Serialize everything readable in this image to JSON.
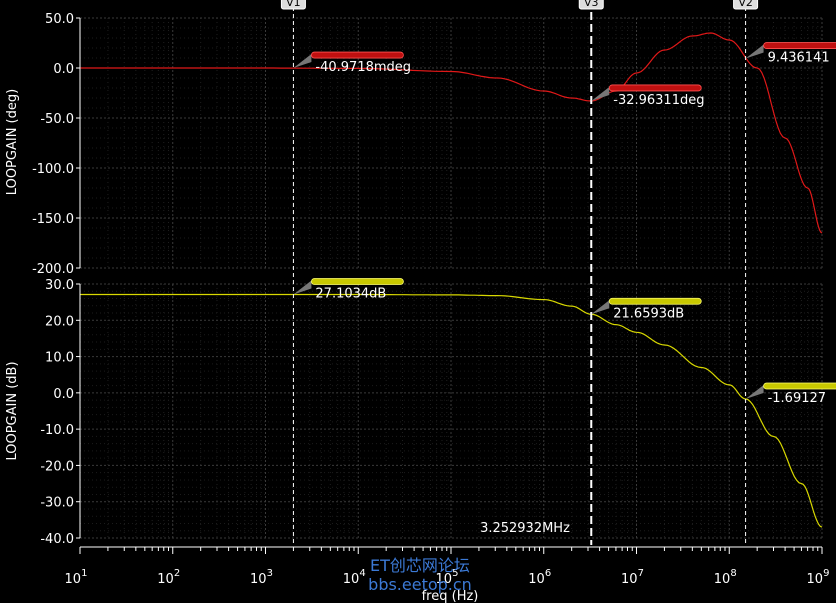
{
  "chart_data": [
    {
      "type": "line",
      "ylabel": "LOOPGAIN (deg)",
      "xlabel": "freq (Hz)",
      "xscale": "log",
      "xlim": [
        10,
        1000000000
      ],
      "ylim": [
        -200,
        50
      ],
      "yticks": [
        "50.0",
        "0.0",
        "-50.0",
        "-100.0",
        "-150.0",
        "-200.0"
      ],
      "grid": true,
      "series": [
        {
          "color": "#e01818",
          "x": [
            10,
            100,
            1000,
            10000,
            100000,
            316228,
            1000000,
            2000000,
            3252932,
            6000000,
            10000000,
            20000000,
            40000000,
            63000000,
            100000000,
            200000000,
            400000000,
            700000000,
            1000000000
          ],
          "y": [
            0,
            0,
            -0.04,
            -0.4,
            -3.5,
            -10,
            -23,
            -30,
            -33,
            -23,
            -5,
            18,
            32,
            35,
            28,
            0,
            -70,
            -120,
            -165
          ]
        }
      ],
      "markers": [
        {
          "label": "-40.9718mdeg",
          "x": 2000,
          "y": -0.04
        },
        {
          "label": "-32.96311deg",
          "x": 3252932,
          "y": -32.96
        },
        {
          "label": "9.436141",
          "x": 150000000,
          "y": 9.44
        }
      ]
    },
    {
      "type": "line",
      "ylabel": "LOOPGAIN (dB)",
      "xlabel": "freq (Hz)",
      "xscale": "log",
      "xlim": [
        10,
        1000000000
      ],
      "ylim": [
        -40,
        30
      ],
      "yticks": [
        "30.0",
        "20.0",
        "10.0",
        "0.0",
        "-10.0",
        "-20.0",
        "-30.0",
        "-40.0"
      ],
      "grid": true,
      "series": [
        {
          "color": "#d8d800",
          "x": [
            10,
            100,
            1000,
            10000,
            100000,
            316228,
            1000000,
            2000000,
            3252932,
            6000000,
            10000000,
            20000000,
            50000000,
            100000000,
            150000000,
            300000000,
            600000000,
            1000000000
          ],
          "y": [
            27.1,
            27.1,
            27.1,
            27.1,
            27.0,
            26.8,
            25.7,
            23.9,
            21.66,
            18.8,
            16.7,
            13.2,
            7.0,
            2.2,
            -1.69,
            -12,
            -25,
            -37
          ]
        }
      ],
      "markers": [
        {
          "label": "27.1034dB",
          "x": 2000,
          "y": 27.1
        },
        {
          "label": "21.6593dB",
          "x": 3252932,
          "y": 21.66
        },
        {
          "label": "-1.69127",
          "x": 150000000,
          "y": -1.69
        }
      ]
    }
  ],
  "x_ticks": [
    {
      "base": "10",
      "exp": "1"
    },
    {
      "base": "10",
      "exp": "2"
    },
    {
      "base": "10",
      "exp": "3"
    },
    {
      "base": "10",
      "exp": "4"
    },
    {
      "base": "10",
      "exp": "5"
    },
    {
      "base": "10",
      "exp": "6"
    },
    {
      "base": "10",
      "exp": "7"
    },
    {
      "base": "10",
      "exp": "8"
    },
    {
      "base": "10",
      "exp": "9"
    }
  ],
  "cursors": [
    {
      "label": "V1",
      "x": 2000
    },
    {
      "label": "V3",
      "x": 3252932
    },
    {
      "label": "V2",
      "x": 150000000
    }
  ],
  "freq_readout": "3.252932MHz",
  "xlabel": "freq (Hz)",
  "watermark": {
    "line1": "ET创芯网论坛",
    "line2": "bbs.eetop.cn"
  },
  "colors": {
    "phase": "#e01818",
    "gain": "#d8d800",
    "background": "#000000",
    "cursor": "#ffffff"
  }
}
